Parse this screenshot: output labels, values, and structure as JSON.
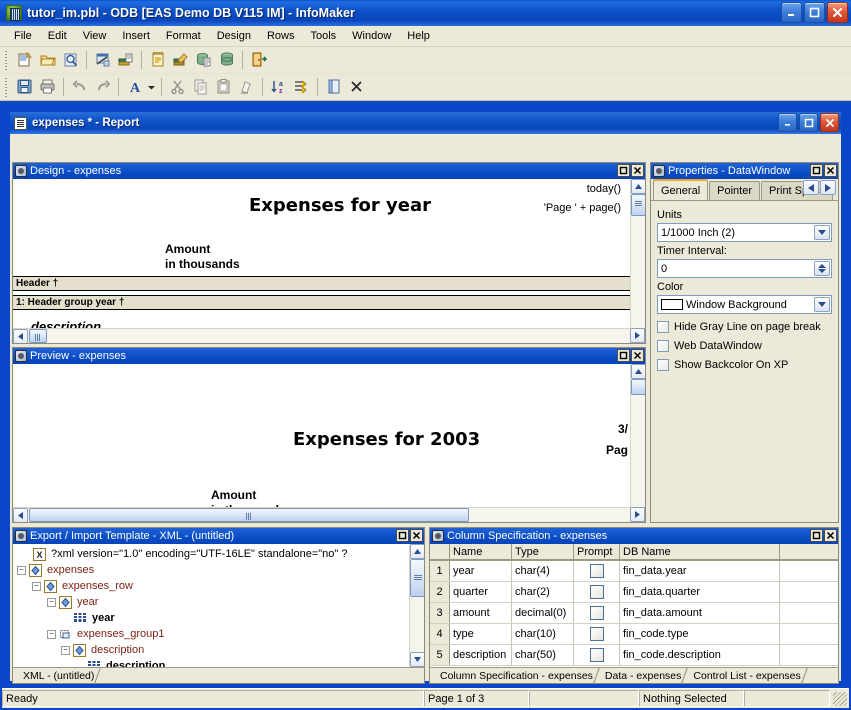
{
  "window": {
    "title": "tutor_im.pbl - ODB [EAS Demo DB V115 IM]  - InfoMaker",
    "minimize": "_",
    "maximize": "□",
    "close": "✕"
  },
  "menu": [
    "File",
    "Edit",
    "View",
    "Insert",
    "Format",
    "Design",
    "Rows",
    "Tools",
    "Window",
    "Help"
  ],
  "toolbar_row1": [
    "new-icon",
    "open-icon",
    "preview-icon",
    "separator",
    "database-profile-icon",
    "library-painter-icon",
    "separator",
    "report-painter-icon",
    "form-painter-icon",
    "db-painter-icon",
    "data-pipeline-icon",
    "separator",
    "exit-icon"
  ],
  "toolbar_row2": [
    "save-icon",
    "print-icon",
    "separator",
    "undo-icon",
    "redo-icon",
    "separator",
    "font-icon",
    "font-dropdown-arrow",
    "separator",
    "cut-icon",
    "copy-icon",
    "paste-icon",
    "clear-icon",
    "separator",
    "sort-icon",
    "filter-icon",
    "separator",
    "properties-icon",
    "close-x-icon"
  ],
  "mdi": {
    "title": "expenses * - Report",
    "minimize": "_",
    "maximize": "□",
    "close": "✕"
  },
  "design_pane": {
    "title": "Design - expenses",
    "restore": "□",
    "close": "✕",
    "report_title": "Expenses for  year",
    "today_expr": "today()",
    "page_expr": "'Page ' + page()",
    "amount_label_line1": "Amount",
    "amount_label_line2": "in thousands",
    "band_header": "Header †",
    "band_group": "1: Header group year †",
    "detail_field": "description"
  },
  "preview_pane": {
    "title": "Preview - expenses",
    "restore": "□",
    "close": "✕",
    "report_title": "Expenses for  2003",
    "date_partial": "3/",
    "page_partial": "Pag",
    "amount_label_line1": "Amount",
    "amount_label_line2": "in thousands"
  },
  "properties_pane": {
    "title": "Properties -  DataWindow",
    "restore": "□",
    "close": "✕",
    "tabs": [
      {
        "label": "General",
        "active": true
      },
      {
        "label": "Pointer",
        "active": false
      },
      {
        "label": "Print Specif",
        "active": false
      }
    ],
    "nav_prev": "◄",
    "nav_next": "►",
    "units_label": "Units",
    "units_value": "1/1000 Inch (2)",
    "timer_label": "Timer Interval:",
    "timer_value": "0",
    "color_label": "Color",
    "color_value": "Window Background",
    "color_swatch": "#ffffff",
    "checkboxes": [
      {
        "label": "Hide Gray Line on page break",
        "checked": false
      },
      {
        "label": "Web DataWindow",
        "checked": false
      },
      {
        "label": "Show Backcolor On XP",
        "checked": false
      }
    ]
  },
  "xml_pane": {
    "title": "Export / Import Template - XML - (untitled)",
    "restore": "□",
    "close": "✕",
    "tree": [
      {
        "indent": 1,
        "expander": "",
        "icon": "xml-declaration-icon",
        "label": "?xml version=\"1.0\" encoding=\"UTF-16LE\" standalone=\"no\" ?",
        "kind": "decl"
      },
      {
        "indent": 0,
        "expander": "-",
        "icon": "xml-element-icon",
        "label": "expenses",
        "kind": "elem"
      },
      {
        "indent": 1,
        "expander": "-",
        "icon": "xml-element-icon",
        "label": "expenses_row",
        "kind": "elem"
      },
      {
        "indent": 2,
        "expander": "-",
        "icon": "xml-element-icon",
        "label": "year",
        "kind": "elem"
      },
      {
        "indent": 3,
        "expander": "",
        "icon": "column-icon",
        "label": "year",
        "kind": "col"
      },
      {
        "indent": 2,
        "expander": "-",
        "icon": "xml-group-icon",
        "label": "expenses_group1",
        "kind": "elem"
      },
      {
        "indent": 3,
        "expander": "-",
        "icon": "xml-element-icon",
        "label": "description",
        "kind": "elem"
      },
      {
        "indent": 4,
        "expander": "",
        "icon": "column-icon",
        "label": "description",
        "kind": "col"
      }
    ],
    "tabs": [
      {
        "label": "XML - (untitled)"
      }
    ]
  },
  "column_spec_pane": {
    "title": "Column Specification - expenses",
    "restore": "□",
    "close": "✕",
    "columns": [
      "Name",
      "Type",
      "Prompt",
      "DB Name"
    ],
    "rows": [
      {
        "num": "1",
        "name": "year",
        "type": "char(4)",
        "prompt": false,
        "db": "fin_data.year"
      },
      {
        "num": "2",
        "name": "quarter",
        "type": "char(2)",
        "prompt": false,
        "db": "fin_data.quarter"
      },
      {
        "num": "3",
        "name": "amount",
        "type": "decimal(0)",
        "prompt": false,
        "db": "fin_data.amount"
      },
      {
        "num": "4",
        "name": "type",
        "type": "char(10)",
        "prompt": false,
        "db": "fin_code.type"
      },
      {
        "num": "5",
        "name": "description",
        "type": "char(50)",
        "prompt": false,
        "db": "fin_code.description"
      }
    ],
    "tabs": [
      {
        "label": "Column Specification - expenses",
        "active": true
      },
      {
        "label": "Data - expenses",
        "active": false
      },
      {
        "label": "Control List - expenses",
        "active": false
      }
    ]
  },
  "statusbar": {
    "ready": "Ready",
    "page": "Page 1 of 3",
    "blank1": "",
    "selection": "Nothing Selected",
    "blank2": ""
  }
}
